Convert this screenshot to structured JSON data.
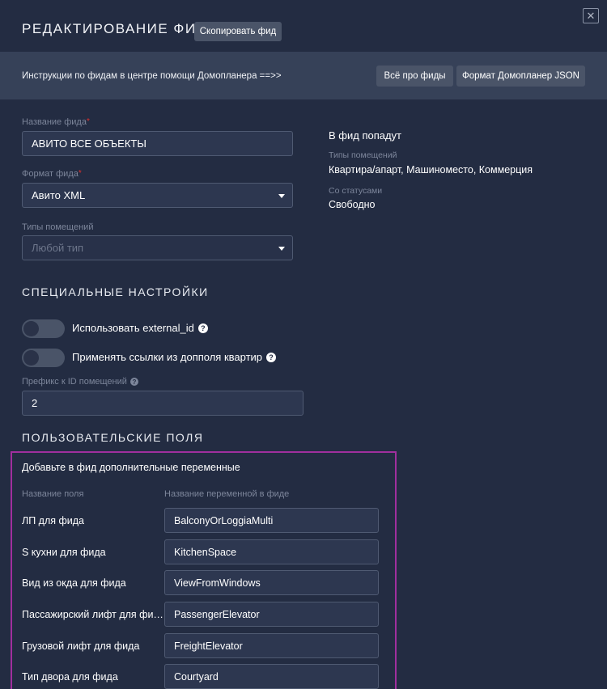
{
  "header": {
    "title": "РЕДАКТИРОВАНИЕ ФИДА",
    "copy_button": "Скопировать фид",
    "close_glyph": "✕"
  },
  "banner": {
    "text": "Инструкции по фидам в центре помощи Домопланера ==>>",
    "btn_about": "Всё про фиды",
    "btn_format": "Формат Домопланер JSON"
  },
  "form": {
    "name_label": "Название фида",
    "name_value": "АВИТО ВСЕ ОБЪЕКТЫ",
    "format_label": "Формат фида",
    "format_value": "Авито XML",
    "types_label": "Типы помещений",
    "types_placeholder": "Любой тип",
    "required_mark": "*"
  },
  "summary": {
    "heading": "В фид попадут",
    "types_label": "Типы помещений",
    "types_value": "Квартира/апарт, Машиноместо, Коммерция",
    "status_label": "Со статусами",
    "status_value": "Свободно"
  },
  "special": {
    "title": "СПЕЦИАЛЬНЫЕ НАСТРОЙКИ",
    "toggle1_label": "Использовать external_id",
    "toggle1_on": false,
    "toggle2_label": "Применять ссылки из допполя квартир",
    "toggle2_on": false,
    "prefix_label": "Префикс к ID помещений",
    "prefix_value": "2",
    "help_glyph": "?"
  },
  "custom": {
    "title": "ПОЛЬЗОВАТЕЛЬСКИЕ ПОЛЯ",
    "hint": "Добавьте в фид дополнительные переменные",
    "col_field": "Название поля",
    "col_var": "Название переменной в фиде",
    "rows": [
      {
        "field": "ЛП для фида",
        "var": "BalconyOrLoggiaMulti"
      },
      {
        "field": "S кухни для фида",
        "var": "KitchenSpace"
      },
      {
        "field": "Вид из окда для фида",
        "var": "ViewFromWindows"
      },
      {
        "field": "Пассажирский лифт для фида",
        "var": "PassengerElevator"
      },
      {
        "field": "Грузовой лифт для фида",
        "var": "FreightElevator"
      },
      {
        "field": "Тип двора для фида",
        "var": "Courtyard"
      }
    ]
  },
  "colors": {
    "background": "#232c42",
    "banner": "#364158",
    "button": "#4a5468",
    "required": "#e0302e",
    "highlight_border": "#a02f9e"
  }
}
